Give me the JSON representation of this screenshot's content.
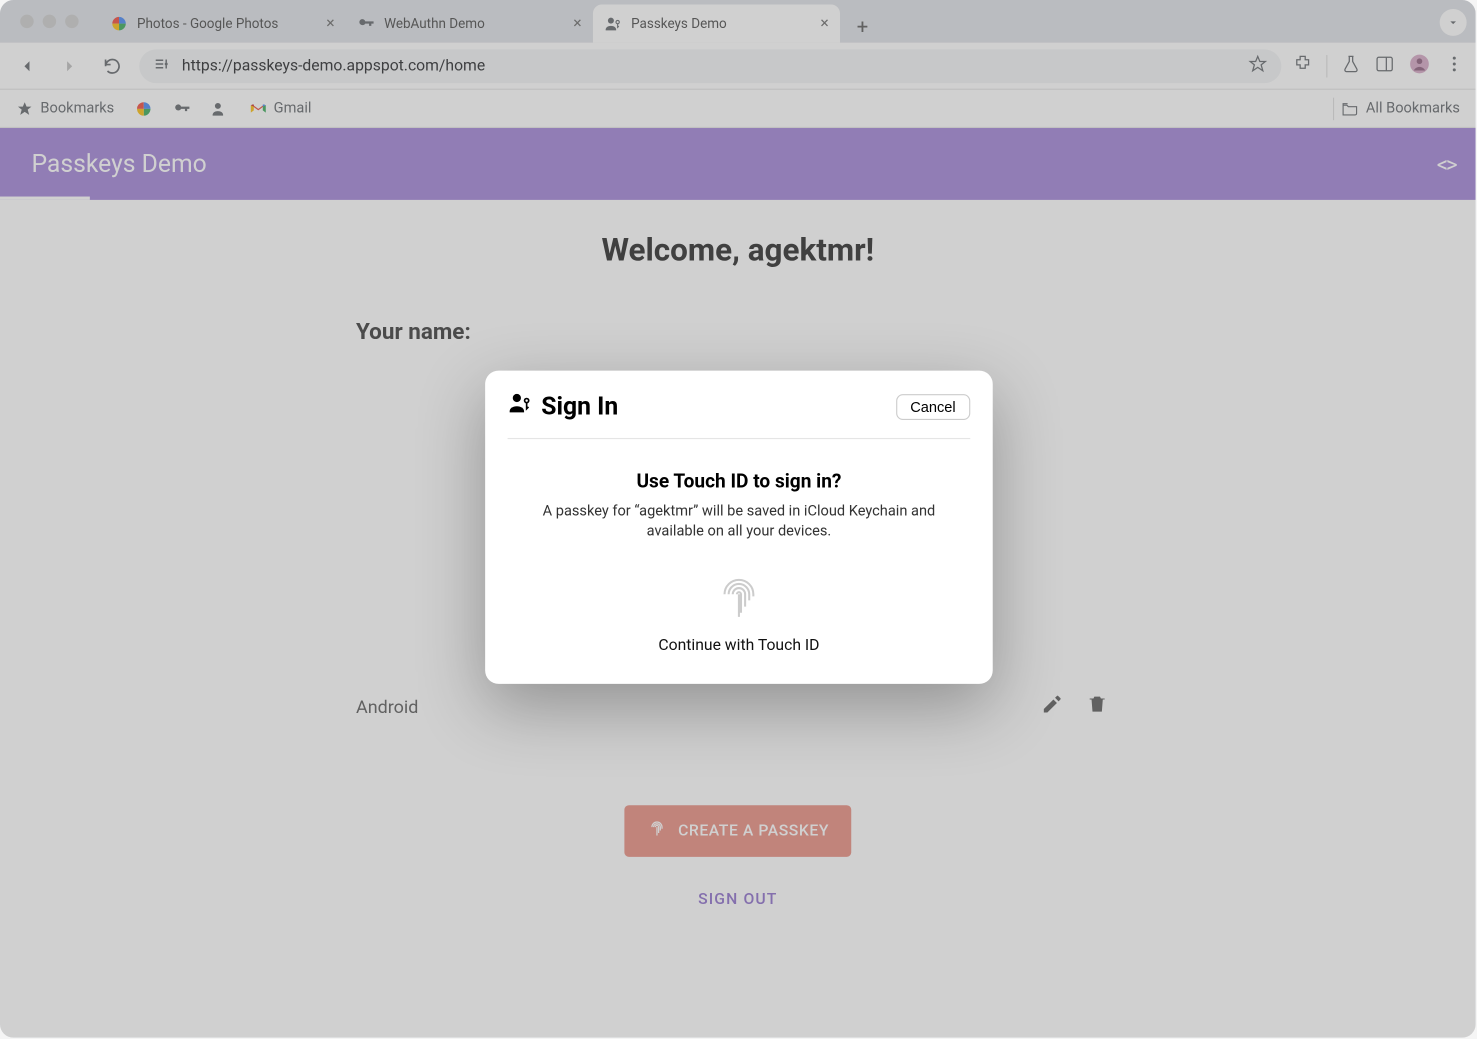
{
  "browser": {
    "tabs": [
      {
        "title": "Photos - Google Photos",
        "active": false
      },
      {
        "title": "WebAuthn Demo",
        "active": false
      },
      {
        "title": "Passkeys Demo",
        "active": true
      }
    ],
    "url": "https://passkeys-demo.appspot.com/home"
  },
  "bookmarks": {
    "label": "Bookmarks",
    "gmail": "Gmail",
    "all": "All Bookmarks"
  },
  "app": {
    "title": "Passkeys Demo",
    "welcome": "Welcome, agektmr!",
    "your_name_label": "Your name:",
    "device_row": {
      "name": "Android"
    },
    "create_button": "CREATE A PASSKEY",
    "sign_out": "SIGN OUT"
  },
  "modal": {
    "title": "Sign In",
    "cancel": "Cancel",
    "heading": "Use Touch ID to sign in?",
    "description": "A passkey for “agektmr” will be saved in iCloud Keychain and available on all your devices.",
    "continue": "Continue with Touch ID"
  }
}
